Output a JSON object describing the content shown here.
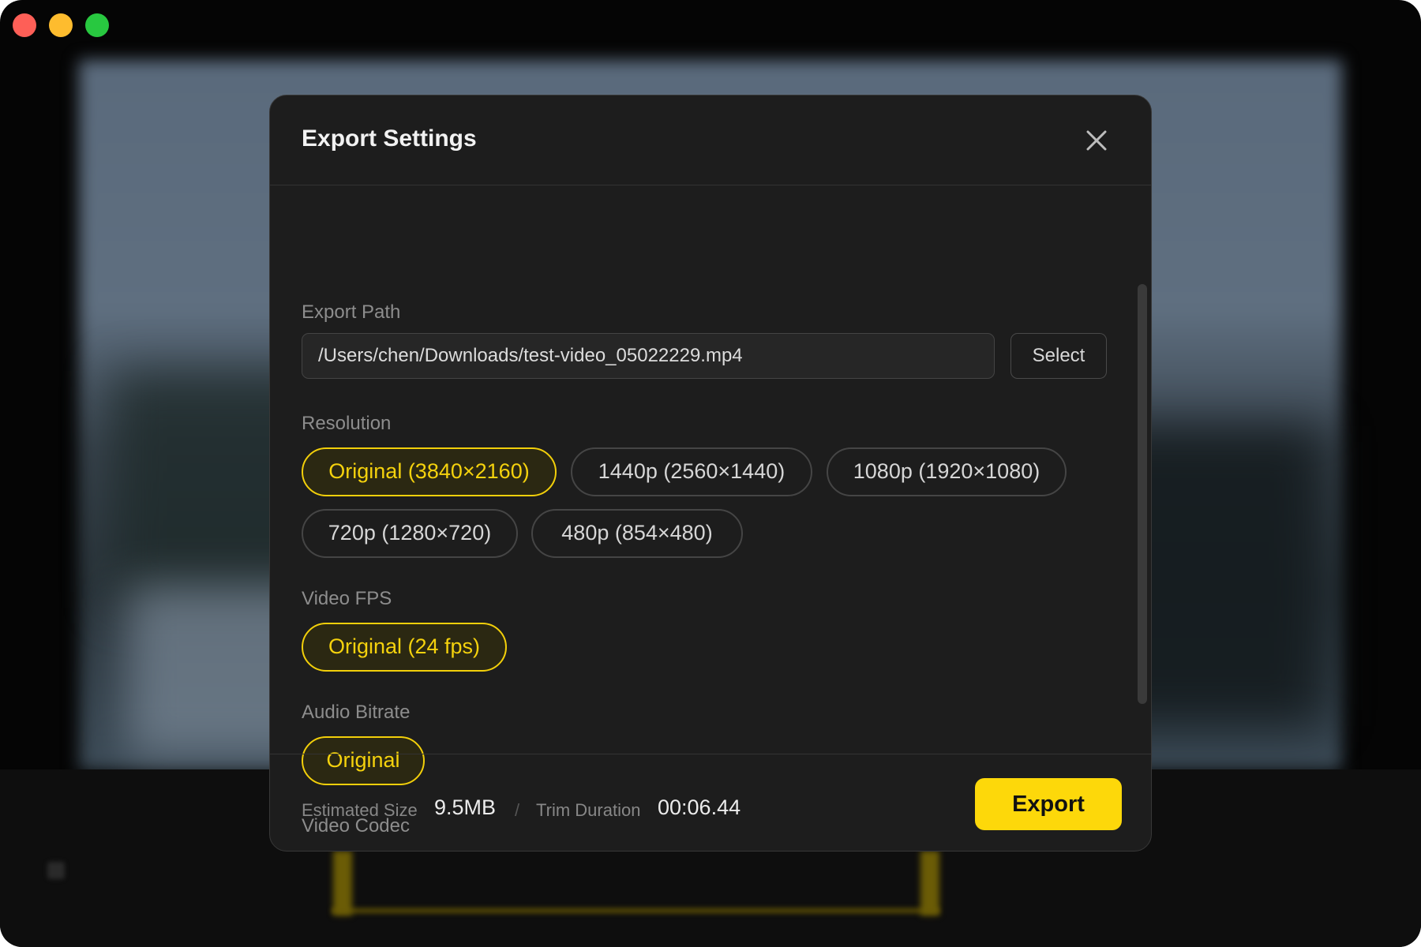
{
  "window": {
    "controls": [
      "close",
      "minimize",
      "zoom"
    ],
    "colors": {
      "close": "#fe5f57",
      "minimize": "#febc2e",
      "zoom": "#28c840"
    }
  },
  "dialog": {
    "title": "Export Settings",
    "close_icon": "close-icon",
    "export_path": {
      "label": "Export Path",
      "value": "/Users/chen/Downloads/test-video_05022229.mp4",
      "select_label": "Select"
    },
    "resolution": {
      "label": "Resolution",
      "options": [
        {
          "label": "Original (3840×2160)",
          "selected": true
        },
        {
          "label": "1440p (2560×1440)",
          "selected": false
        },
        {
          "label": "1080p (1920×1080)",
          "selected": false
        },
        {
          "label": "720p (1280×720)",
          "selected": false
        },
        {
          "label": "480p (854×480)",
          "selected": false
        }
      ]
    },
    "fps": {
      "label": "Video FPS",
      "options": [
        {
          "label": "Original (24 fps)",
          "selected": true
        }
      ]
    },
    "audio_bitrate": {
      "label": "Audio Bitrate",
      "options": [
        {
          "label": "Original",
          "selected": true
        }
      ]
    },
    "video_codec": {
      "label": "Video Codec"
    },
    "footer": {
      "estimated_size_label": "Estimated Size",
      "estimated_size_value": "9.5MB",
      "separator": "/",
      "trim_duration_label": "Trim Duration",
      "trim_duration_value": "00:06.44",
      "export_label": "Export"
    }
  },
  "colors": {
    "accent": "#fdd80a",
    "selected_chip_border": "#f2cf0a",
    "dialog_bg": "#1d1d1d"
  }
}
